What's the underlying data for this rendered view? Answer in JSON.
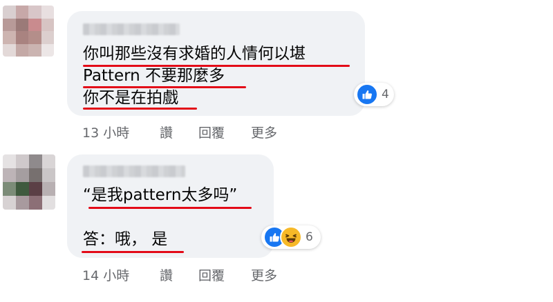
{
  "comments": [
    {
      "lines": [
        "你叫那些沒有求婚的人情何以堪",
        "Pattern 不要那麼多",
        "你不是在拍戲"
      ],
      "reactions": {
        "count": "4",
        "types": [
          "like-icon"
        ]
      },
      "meta": {
        "time": "13 小時",
        "like": "讚",
        "reply": "回覆",
        "more": "更多"
      }
    },
    {
      "lines": [
        "“是我pattern太多吗”",
        "答：哦， 是"
      ],
      "reactions": {
        "count": "6",
        "types": [
          "like-icon",
          "haha-icon"
        ]
      },
      "meta": {
        "time": "14 小時",
        "like": "讚",
        "reply": "回覆",
        "more": "更多"
      }
    }
  ],
  "colors": {
    "bubble": "#f0f2f5",
    "underline": "#e30a17",
    "like": "#1877f2",
    "haha": "#f7b928",
    "meta_text": "#65676b"
  }
}
